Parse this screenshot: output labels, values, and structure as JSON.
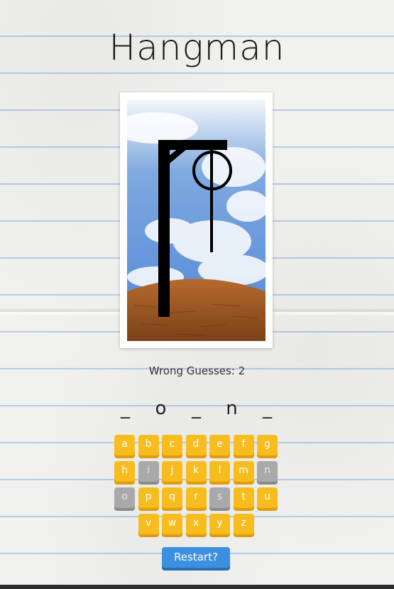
{
  "title": "Hangman",
  "status": {
    "label": "Wrong Guesses:",
    "count": "2"
  },
  "word": {
    "slots": [
      "_",
      "o",
      "_",
      "n",
      "_"
    ]
  },
  "keyboard": {
    "rows": [
      [
        {
          "letter": "a",
          "used": false
        },
        {
          "letter": "b",
          "used": false
        },
        {
          "letter": "c",
          "used": false
        },
        {
          "letter": "d",
          "used": false
        },
        {
          "letter": "e",
          "used": false
        },
        {
          "letter": "f",
          "used": false
        },
        {
          "letter": "g",
          "used": false
        }
      ],
      [
        {
          "letter": "h",
          "used": false
        },
        {
          "letter": "i",
          "used": true
        },
        {
          "letter": "j",
          "used": false
        },
        {
          "letter": "k",
          "used": false
        },
        {
          "letter": "l",
          "used": false
        },
        {
          "letter": "m",
          "used": false
        },
        {
          "letter": "n",
          "used": true
        }
      ],
      [
        {
          "letter": "o",
          "used": true
        },
        {
          "letter": "p",
          "used": false
        },
        {
          "letter": "q",
          "used": false
        },
        {
          "letter": "r",
          "used": false
        },
        {
          "letter": "s",
          "used": true
        },
        {
          "letter": "t",
          "used": false
        },
        {
          "letter": "u",
          "used": false
        }
      ],
      [
        {
          "letter": "v",
          "used": false
        },
        {
          "letter": "w",
          "used": false
        },
        {
          "letter": "x",
          "used": false
        },
        {
          "letter": "y",
          "used": false
        },
        {
          "letter": "z",
          "used": false
        }
      ]
    ]
  },
  "restart_label": "Restart?",
  "colors": {
    "key": "#f7bc1d",
    "key_used": "#a9a9a9",
    "restart": "#3d8fe0"
  }
}
